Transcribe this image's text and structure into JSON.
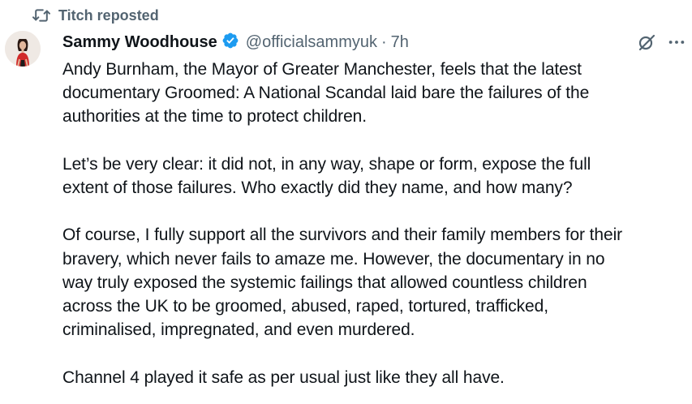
{
  "repost": {
    "label": "Titch reposted",
    "icon": "repost-icon"
  },
  "author": {
    "name": "Sammy Woodhouse",
    "verified": true,
    "verified_color": "#1d9bf0",
    "handle": "@officialsammyuk",
    "separator": "·",
    "time": "7h"
  },
  "actions": {
    "grok_icon": "grok-icon",
    "more_icon": "more-icon"
  },
  "post": {
    "paragraphs": [
      [
        "Andy Burnham, the Mayor of Greater Manchester, feels that the latest",
        "documentary Groomed: A National Scandal laid bare the failures of the",
        "authorities at the time to protect children."
      ],
      [
        "Let’s be very clear: it did not, in any way, shape or form, expose the full",
        "extent of those failures. Who exactly did they name, and how many?"
      ],
      [
        "Of course, I fully support all the survivors and their family members for their",
        "bravery, which never fails to amaze me. However, the documentary in no",
        "way truly exposed the systemic failings that allowed countless children",
        "across the UK to be groomed, abused, raped, tortured, trafficked,",
        "criminalised, impregnated, and even murdered."
      ],
      [
        "Channel 4 played it safe as per usual just like they all have."
      ]
    ]
  }
}
